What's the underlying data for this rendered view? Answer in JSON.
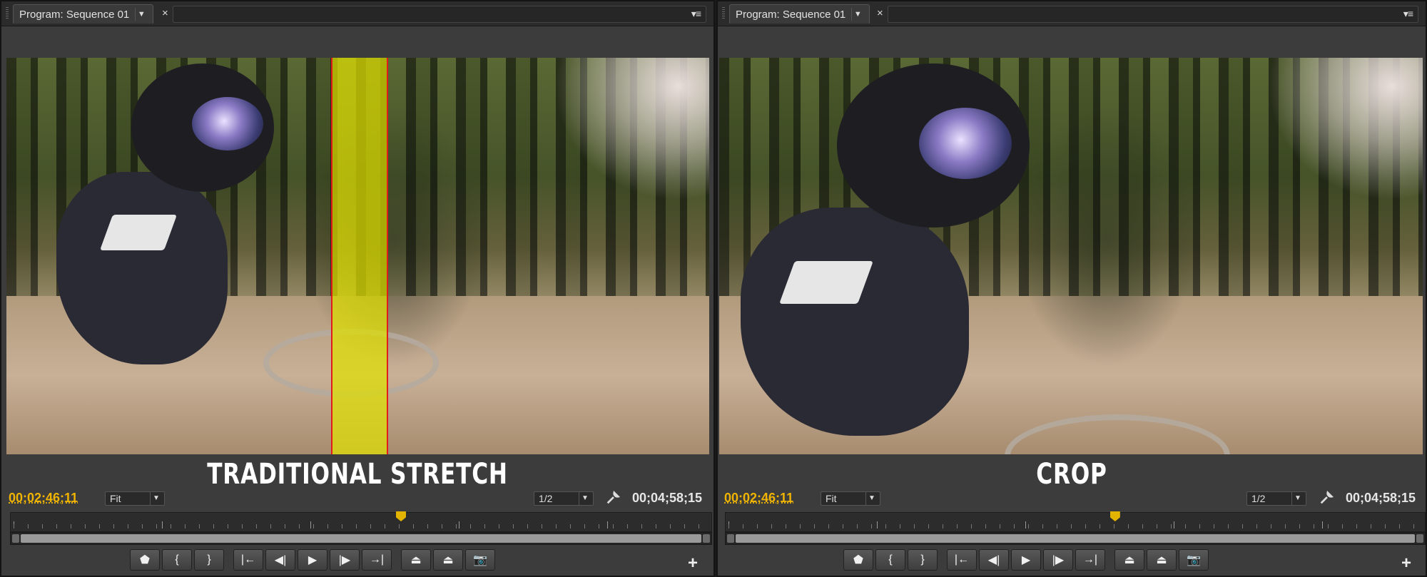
{
  "colors": {
    "timecode_current": "#f0b400",
    "stripe_fill": "#e1e100",
    "stripe_border": "#e21a1a",
    "panel_bg": "#3c3c3c"
  },
  "panels": [
    {
      "tab_title": "Program: Sequence 01",
      "tab_dropdown_icon": "chevron-down-icon",
      "close_glyph": "×",
      "panel_menu_glyph": "▾≡",
      "overlay_title": "TRADITIONAL STRETCH",
      "current_timecode": "00;02;46;11",
      "zoom_label": "Fit",
      "resolution_label": "1/2",
      "total_timecode": "00;04;58;15",
      "highlight_stripe": true
    },
    {
      "tab_title": "Program: Sequence 01",
      "tab_dropdown_icon": "chevron-down-icon",
      "close_glyph": "×",
      "panel_menu_glyph": "▾≡",
      "overlay_title": "CROP",
      "current_timecode": "00;02;46;11",
      "zoom_label": "Fit",
      "resolution_label": "1/2",
      "total_timecode": "00;04;58;15",
      "highlight_stripe": false
    }
  ],
  "playhead_position_fraction": 0.557,
  "transport_buttons": [
    {
      "name": "add-marker-button",
      "icon": "marker-icon",
      "glyph": "⬟"
    },
    {
      "name": "mark-in-button",
      "icon": "mark-in-icon",
      "glyph": "{"
    },
    {
      "name": "mark-out-button",
      "icon": "mark-out-icon",
      "glyph": "}"
    },
    {
      "name": "go-to-in-button",
      "icon": "go-to-in-icon",
      "glyph": "|←"
    },
    {
      "name": "step-back-button",
      "icon": "step-back-icon",
      "glyph": "◀|"
    },
    {
      "name": "play-button",
      "icon": "play-icon",
      "glyph": "▶"
    },
    {
      "name": "step-forward-button",
      "icon": "step-forward-icon",
      "glyph": "|▶"
    },
    {
      "name": "go-to-out-button",
      "icon": "go-to-out-icon",
      "glyph": "→|"
    },
    {
      "name": "lift-button",
      "icon": "lift-icon",
      "glyph": "⏏"
    },
    {
      "name": "extract-button",
      "icon": "extract-icon",
      "glyph": "⏏"
    },
    {
      "name": "export-frame-button",
      "icon": "camera-icon",
      "glyph": "📷"
    }
  ],
  "add_button_glyph": "+"
}
